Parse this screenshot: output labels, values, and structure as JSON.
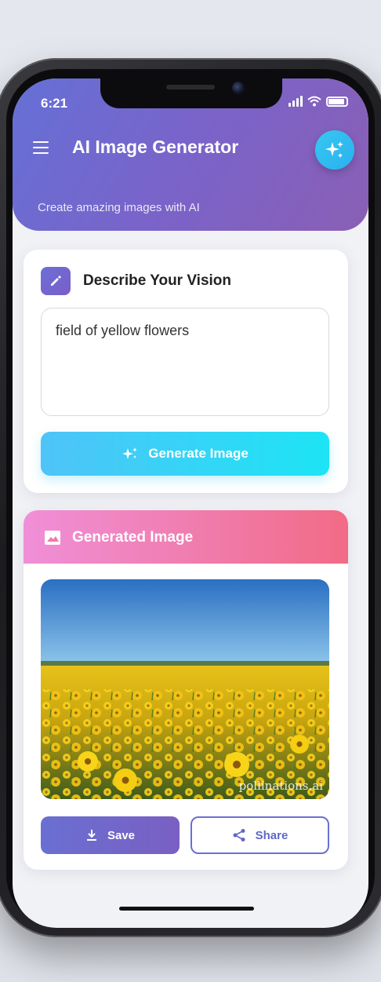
{
  "status_bar": {
    "time": "6:21"
  },
  "header": {
    "title": "AI Image Generator",
    "subtitle": "Create amazing images with AI"
  },
  "prompt_card": {
    "title": "Describe Your Vision",
    "prompt_value": "field of yellow flowers",
    "generate_label": "Generate Image"
  },
  "result_card": {
    "title": "Generated Image",
    "watermark": "pollinations.ai",
    "save_label": "Save",
    "share_label": "Share"
  },
  "colors": {
    "header_start": "#6570d6",
    "header_end": "#8a5fb5",
    "accent_cyan": "#1de4f5",
    "result_header_pink": "#f07aa8",
    "button_purple": "#6a6fd2"
  },
  "icons": [
    "menu-icon",
    "sparkle-icon",
    "pencil-icon",
    "image-icon",
    "download-icon",
    "share-icon"
  ]
}
